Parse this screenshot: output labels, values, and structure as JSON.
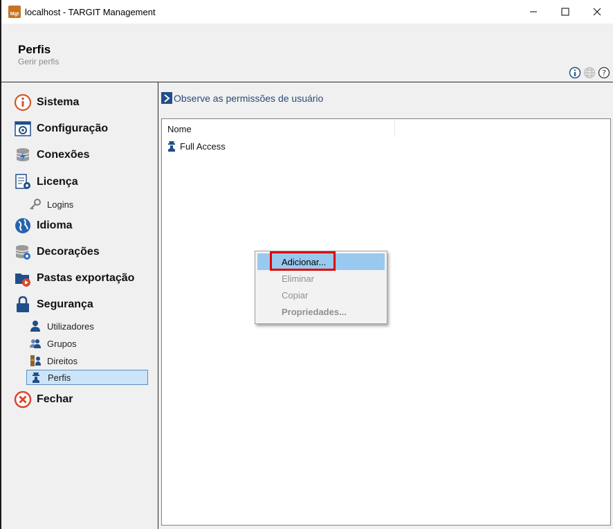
{
  "window": {
    "title": "localhost - TARGIT Management",
    "app_icon_text": "Mgt"
  },
  "header": {
    "title": "Perfis",
    "subtitle": "Gerir perfis"
  },
  "sidebar": {
    "items": [
      {
        "label": "Sistema",
        "icon": "info-icon"
      },
      {
        "label": "Configuração",
        "icon": "settings-window-icon"
      },
      {
        "label": "Conexões",
        "icon": "database-connection-icon"
      },
      {
        "label": "Licença",
        "icon": "license-icon"
      },
      {
        "label": "Logins",
        "icon": "key-icon"
      },
      {
        "label": "Idioma",
        "icon": "globe-icon"
      },
      {
        "label": "Decorações",
        "icon": "database-gear-icon"
      },
      {
        "label": "Pastas exportação",
        "icon": "folder-export-icon"
      },
      {
        "label": "Segurança",
        "icon": "lock-icon"
      },
      {
        "label": "Utilizadores",
        "icon": "user-icon"
      },
      {
        "label": "Grupos",
        "icon": "group-icon"
      },
      {
        "label": "Direitos",
        "icon": "rights-icon"
      },
      {
        "label": "Perfis",
        "icon": "profile-icon",
        "selected": true
      },
      {
        "label": "Fechar",
        "icon": "close-circle-icon"
      }
    ]
  },
  "content": {
    "hint": "Observe as permissões de usuário",
    "column_header": "Nome",
    "rows": [
      {
        "label": "Full Access",
        "icon": "profile-icon"
      }
    ]
  },
  "context_menu": {
    "items": [
      {
        "label": "Adicionar...",
        "state": "highlighted"
      },
      {
        "label": "Eliminar",
        "state": "disabled"
      },
      {
        "label": "Copiar",
        "state": "disabled"
      },
      {
        "label": "Propriedades...",
        "state": "disabled-bold"
      }
    ]
  },
  "colors": {
    "accent_blue": "#1f4e8a",
    "highlight_red": "#e00000",
    "menu_hover": "#99c9ef",
    "selection": "#cce4f7"
  }
}
